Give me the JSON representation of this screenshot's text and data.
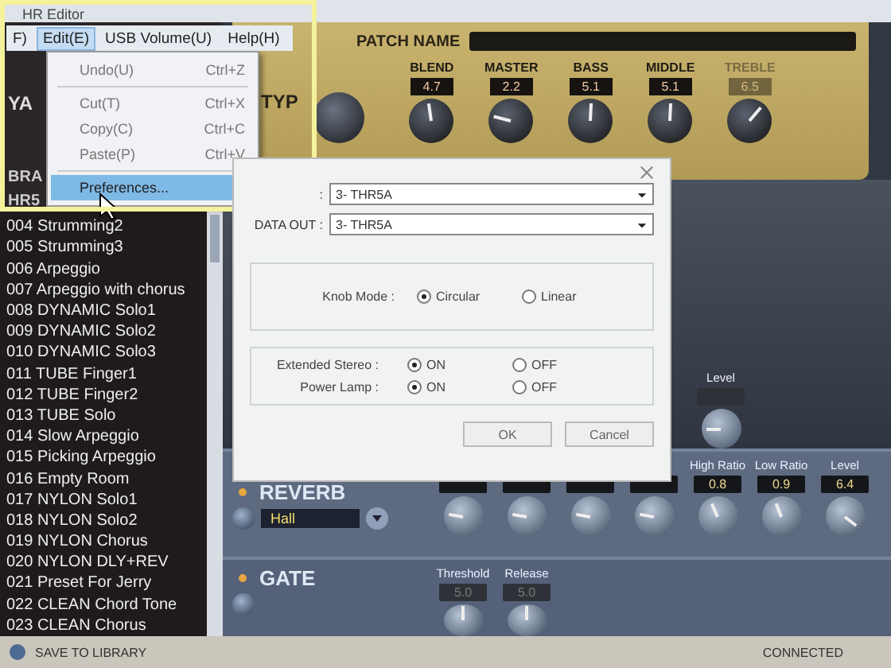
{
  "window": {
    "title": "HR Editor"
  },
  "menu_bar": [
    {
      "label": "F)",
      "selected": false
    },
    {
      "label": "Edit(E)",
      "selected": true
    },
    {
      "label": "USB Volume(U)",
      "selected": false
    },
    {
      "label": "Help(H)",
      "selected": false
    }
  ],
  "edit_menu": [
    {
      "label": "Undo(U)",
      "shortcut": "Ctrl+Z",
      "selected": false
    },
    {
      "label": "Cut(T)",
      "shortcut": "Ctrl+X",
      "selected": false
    },
    {
      "label": "Copy(C)",
      "shortcut": "Ctrl+C",
      "selected": false
    },
    {
      "label": "Paste(P)",
      "shortcut": "Ctrl+V",
      "selected": false
    },
    {
      "label": "Preferences...",
      "selected": true
    }
  ],
  "sidebar": {
    "logo": "YA",
    "brand_label": "BRA",
    "model": "HR5",
    "patches": [
      "004 Strumming2",
      "005 Strumming3",
      "006 Arpeggio",
      "007 Arpeggio with chorus",
      "008 DYNAMIC Solo1",
      "009 DYNAMIC Solo2",
      "010 DYNAMIC Solo3",
      "011 TUBE Finger1",
      "012 TUBE Finger2",
      "013 TUBE Solo",
      "014 Slow Arpeggio",
      "015 Picking Arpeggio",
      "016 Empty Room",
      "017 NYLON Solo1",
      "018 NYLON Solo2",
      "019 NYLON Chorus",
      "020 NYLON DLY+REV",
      "021 Preset For Jerry",
      "022 CLEAN Chord Tone",
      "023 CLEAN Chorus"
    ]
  },
  "amp": {
    "type_label": "TYP",
    "patch_name_label": "PATCH NAME",
    "knobs": [
      {
        "label": "BLEND",
        "value": "4.7",
        "disabled": false
      },
      {
        "label": "MASTER",
        "value": "2.2",
        "disabled": false
      },
      {
        "label": "BASS",
        "value": "5.1",
        "disabled": false
      },
      {
        "label": "MIDDLE",
        "value": "5.1",
        "disabled": false
      },
      {
        "label": "TREBLE",
        "value": "6.5",
        "disabled": true
      }
    ]
  },
  "preferences_dialog": {
    "fields": [
      {
        "label": ":",
        "value": "3- THR5A"
      },
      {
        "label": "DATA OUT :",
        "value": "3- THR5A"
      }
    ],
    "knob_mode": {
      "label": "Knob Mode :",
      "options": [
        {
          "label": "Circular",
          "selected": true
        },
        {
          "label": "Linear",
          "selected": false
        }
      ]
    },
    "settings": [
      {
        "label": "Extended Stereo :",
        "options": [
          {
            "label": "ON",
            "selected": true
          },
          {
            "label": "OFF",
            "selected": false
          }
        ]
      },
      {
        "label": "Power Lamp :",
        "options": [
          {
            "label": "ON",
            "selected": true
          },
          {
            "label": "OFF",
            "selected": false
          }
        ]
      }
    ],
    "buttons": [
      "OK",
      "Cancel"
    ]
  },
  "effects": {
    "upper_level": {
      "label": "Level",
      "disabled": true
    },
    "reverb": {
      "name": "REVERB",
      "on": true,
      "type": "Hall",
      "knobs": [
        {
          "kind": "covered"
        },
        {
          "kind": "covered"
        },
        {
          "kind": "covered"
        },
        {
          "kind": "covered"
        },
        {
          "kind": "labeled",
          "label": "High Ratio",
          "value": "0.8",
          "disabled": false
        },
        {
          "kind": "labeled",
          "label": "Low Ratio",
          "value": "0.9",
          "disabled": false
        },
        {
          "kind": "labeled",
          "label": "Level",
          "value": "6.4",
          "disabled": false
        }
      ]
    },
    "gate": {
      "name": "GATE",
      "on": true,
      "knobs": [
        {
          "label": "Threshold",
          "value": "5.0",
          "disabled": true
        },
        {
          "label": "Release",
          "value": "5.0",
          "disabled": true
        }
      ]
    }
  },
  "footer": {
    "save": "SAVE TO LIBRARY",
    "status": "CONNECTED"
  }
}
